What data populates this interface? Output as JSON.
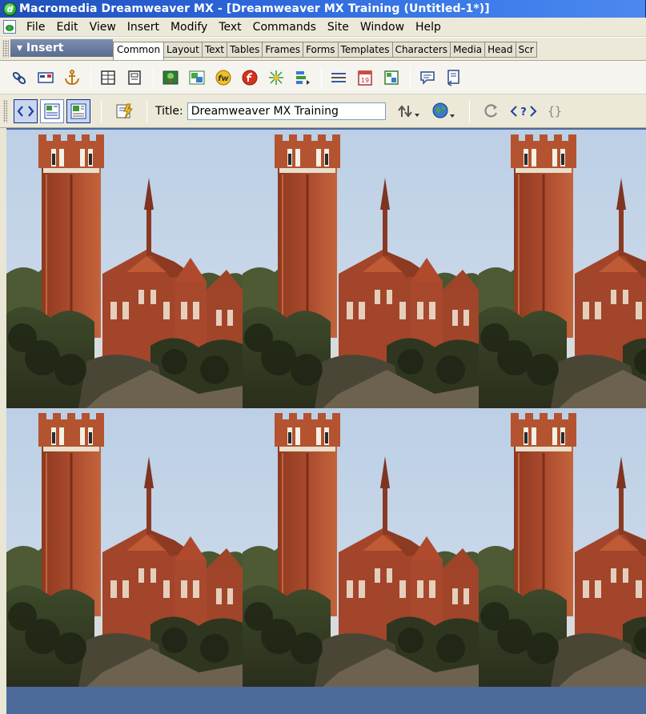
{
  "window": {
    "title": "Macromedia Dreamweaver MX - [Dreamweaver MX Training (Untitled-1*)]"
  },
  "menubar": {
    "items": [
      "File",
      "Edit",
      "View",
      "Insert",
      "Modify",
      "Text",
      "Commands",
      "Site",
      "Window",
      "Help"
    ]
  },
  "insert_bar": {
    "panel_label": "▾ Insert",
    "tabs": [
      "Common",
      "Layout",
      "Text",
      "Tables",
      "Frames",
      "Forms",
      "Templates",
      "Characters",
      "Media",
      "Head",
      "Scr"
    ],
    "active_tab": "Common"
  },
  "common_objects": {
    "icons": [
      "hyperlink-icon",
      "email-link-icon",
      "named-anchor-icon",
      "table-icon",
      "layer-icon",
      "image-icon",
      "image-placeholder-icon",
      "fireworks-html-icon",
      "flash-icon",
      "rollover-image-icon",
      "navigation-bar-icon",
      "horizontal-rule-icon",
      "date-icon",
      "tabular-data-icon",
      "comment-icon",
      "tag-chooser-icon"
    ]
  },
  "document_toolbar": {
    "view_buttons": [
      "Code",
      "Split",
      "Design"
    ],
    "title_label": "Title:",
    "title_value": "Dreamweaver MX Training",
    "icons": [
      "file-management-icon",
      "preview-browser-icon",
      "refresh-icon",
      "code-navigation-icon",
      "braces-icon"
    ]
  },
  "document": {
    "background": "tiled photo of a brick clock tower and collegiate gothic building",
    "tile_count": 6
  },
  "colors": {
    "titlebar": "#2b64d8",
    "chrome": "#ece9d8",
    "active_tab": "#ffffff",
    "brick": "#a8482c",
    "sky": "#c9d8e8"
  }
}
